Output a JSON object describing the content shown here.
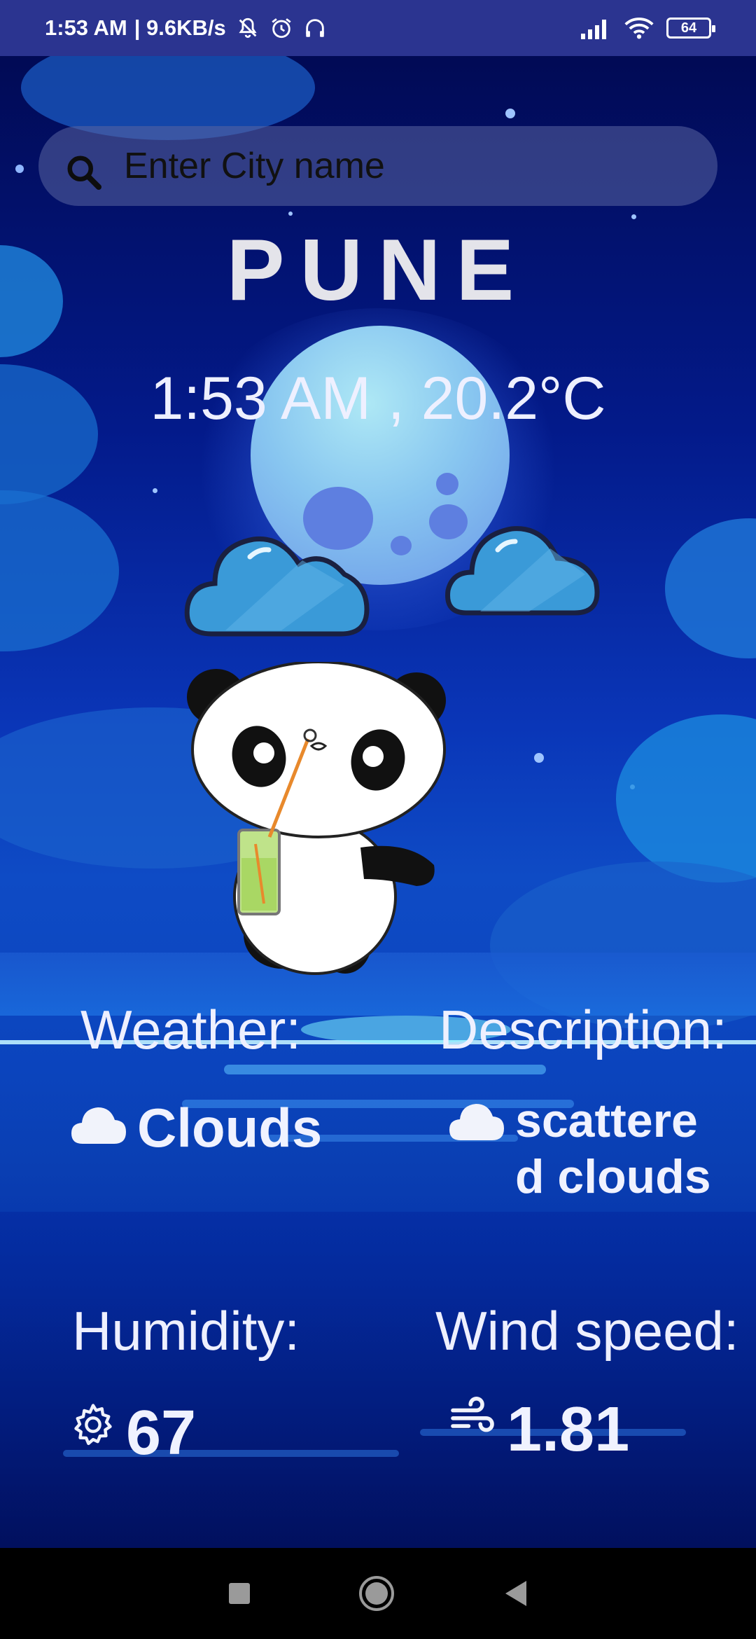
{
  "status_bar": {
    "time": "1:53 AM",
    "net_speed": "| 9.6KB/s",
    "battery": "64",
    "icons": [
      "mute-icon",
      "alarm-icon",
      "headphones-icon",
      "signal-icon",
      "wifi-icon",
      "battery-icon"
    ]
  },
  "search": {
    "placeholder": "Enter City name",
    "value": ""
  },
  "city": "PUNE",
  "time_temp": "1:53 AM , 20.2°C",
  "weather": {
    "label": "Weather:",
    "value": "Clouds",
    "icon": "cloud-icon"
  },
  "description": {
    "label": "Description:",
    "value_line1": "scattere",
    "value_line2": "d clouds",
    "icon": "cloud-icon"
  },
  "humidity": {
    "label": "Humidity:",
    "value": "67",
    "icon": "gear-icon"
  },
  "wind": {
    "label": "Wind speed:",
    "value": "1.81",
    "icon": "wind-icon"
  },
  "nav": [
    "recents-button",
    "home-button",
    "back-button"
  ],
  "colors": {
    "background_top": "#010a55",
    "background_mid": "#0e4bc5",
    "status_bar": "#2b3490",
    "text": "#eef0ff"
  }
}
